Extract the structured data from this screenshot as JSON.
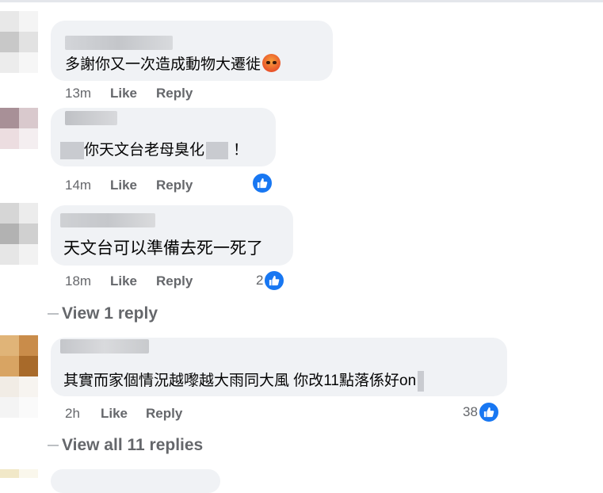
{
  "comments": [
    {
      "text": "多謝你又一次造成動物大遷徙",
      "time": "13m",
      "like_label": "Like",
      "reply_label": "Reply",
      "reaction": "angry"
    },
    {
      "text_before": "你天文台老母臭化",
      "text_after": "！",
      "time": "14m",
      "like_label": "Like",
      "reply_label": "Reply",
      "reaction": "like"
    },
    {
      "text": "天文台可以準備去死一死了",
      "time": "18m",
      "like_label": "Like",
      "reply_label": "Reply",
      "reaction": "like",
      "reaction_count": "2",
      "view_replies": "View 1 reply"
    },
    {
      "text": "其實而家個情況越嚟越大雨同大風 你改11點落係好on",
      "time": "2h",
      "like_label": "Like",
      "reply_label": "Reply",
      "reaction": "like",
      "reaction_count": "38",
      "view_replies": "View all 11 replies"
    }
  ],
  "colors": {
    "bubble": "#f0f2f5",
    "meta": "#65676b",
    "like_blue": "#1877f2"
  }
}
